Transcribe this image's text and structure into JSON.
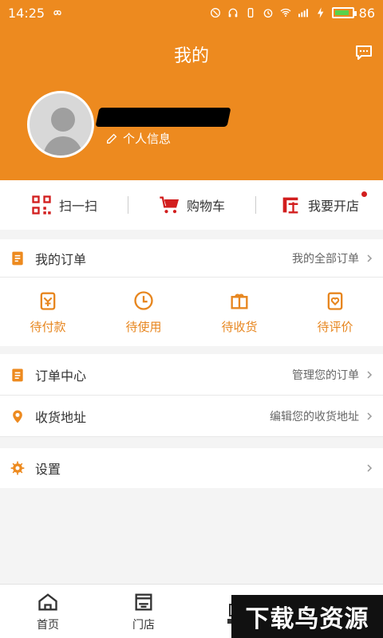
{
  "status": {
    "time": "14:25",
    "battery_text": "86",
    "battery_level": 0.86,
    "icons": [
      "infinity-icon",
      "mute-icon",
      "headphones-icon",
      "vibration-icon",
      "alarm-icon",
      "wifi-icon",
      "signal-icon",
      "bolt-icon",
      "battery-icon"
    ]
  },
  "header": {
    "title": "我的",
    "profile_link": "个人信息"
  },
  "quick_actions": [
    {
      "label": "扫一扫",
      "icon": "qr-scan-icon"
    },
    {
      "label": "购物车",
      "icon": "cart-icon"
    },
    {
      "label": "我要开店",
      "icon": "shop-icon",
      "badge": true
    }
  ],
  "orders": {
    "title": "我的订单",
    "all_link": "我的全部订单",
    "statuses": [
      {
        "label": "待付款",
        "icon": "wallet-icon"
      },
      {
        "label": "待使用",
        "icon": "clock-icon"
      },
      {
        "label": "待收货",
        "icon": "gift-icon"
      },
      {
        "label": "待评价",
        "icon": "review-icon"
      }
    ]
  },
  "menu": {
    "order_center": {
      "label": "订单中心",
      "right": "管理您的订单"
    },
    "address": {
      "label": "收货地址",
      "right": "编辑您的收货地址"
    },
    "settings": {
      "label": "设置"
    }
  },
  "bottom_nav": [
    {
      "label": "首页",
      "icon": "home-icon"
    },
    {
      "label": "门店",
      "icon": "store-icon"
    }
  ],
  "watermark": "下载鸟资源",
  "colors": {
    "brand": "#ed8a1f",
    "accent_red": "#d21e1e",
    "accent_orange": "#e7861f"
  }
}
